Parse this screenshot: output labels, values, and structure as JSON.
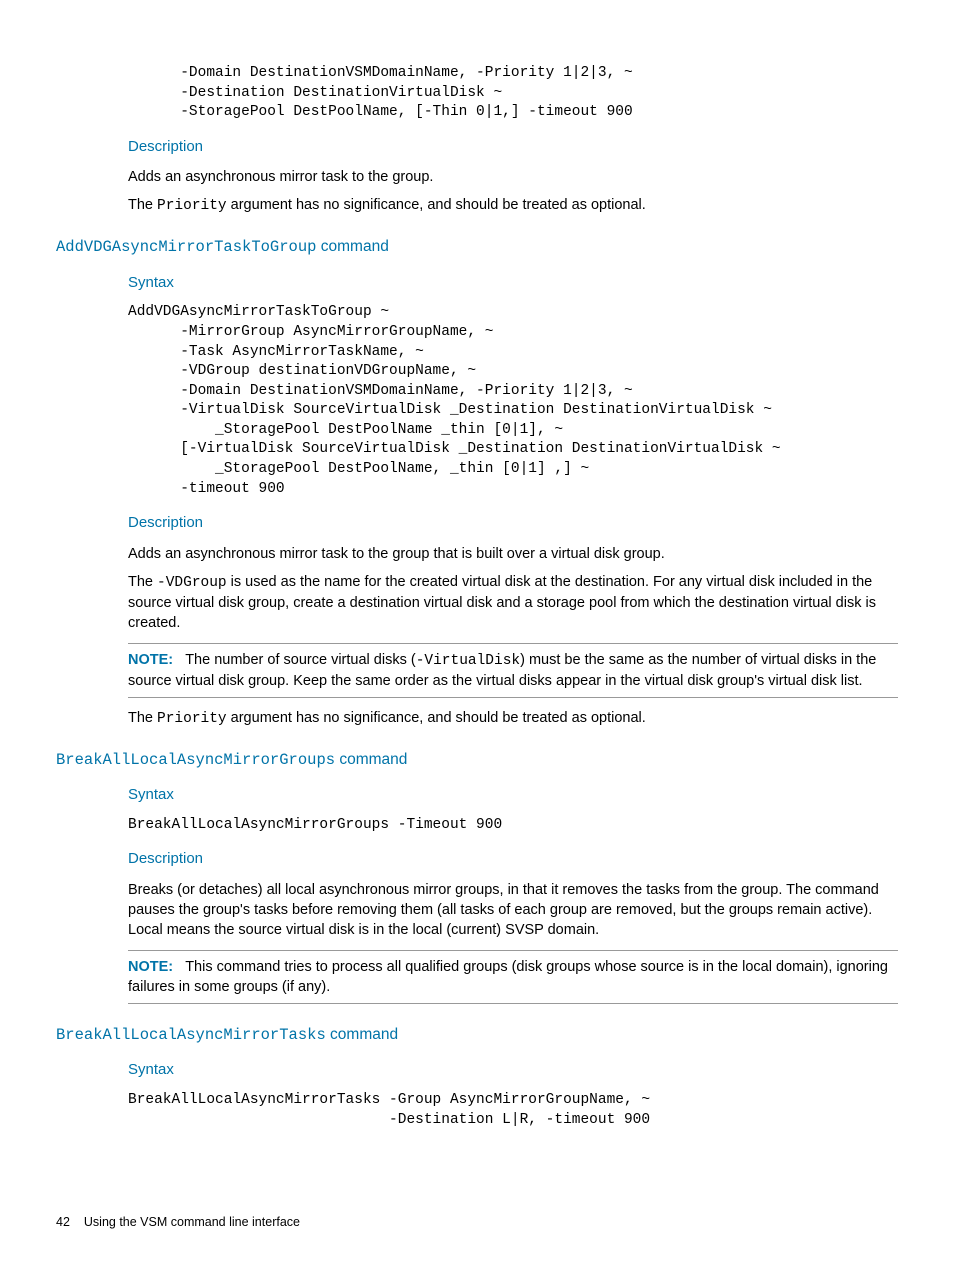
{
  "section1": {
    "code_frag": "      -Domain DestinationVSMDomainName, -Priority 1|2|3, ~\n      -Destination DestinationVirtualDisk ~\n      -StoragePool DestPoolName, [-Thin 0|1,] -timeout 900",
    "desc_h": "Description",
    "p1": "Adds an asynchronous mirror task to the group.",
    "p2a": "The ",
    "p2b": "Priority",
    "p2c": " argument has no significance, and should be treated as optional."
  },
  "section2": {
    "title_cmd": "AddVDGAsyncMirrorTaskToGroup",
    "title_suffix": " command",
    "syntax_h": "Syntax",
    "code": "AddVDGAsyncMirrorTaskToGroup ~\n      -MirrorGroup AsyncMirrorGroupName, ~\n      -Task AsyncMirrorTaskName, ~\n      -VDGroup destinationVDGroupName, ~\n      -Domain DestinationVSMDomainName, -Priority 1|2|3, ~\n      -VirtualDisk SourceVirtualDisk _Destination DestinationVirtualDisk ~\n          _StoragePool DestPoolName _thin [0|1], ~\n      [-VirtualDisk SourceVirtualDisk _Destination DestinationVirtualDisk ~\n          _StoragePool DestPoolName, _thin [0|1] ,] ~\n      -timeout 900",
    "desc_h": "Description",
    "p1": "Adds an asynchronous mirror task to the group that is built over a virtual disk group.",
    "p2a": "The ",
    "p2b": "-VDGroup",
    "p2c": " is used as the name for the created virtual disk at the destination. For any virtual disk included in the source virtual disk group, create a destination virtual disk and a storage pool from which the destination virtual disk is created.",
    "note_label": "NOTE:",
    "note_a": "The number of source virtual disks (",
    "note_b": "-VirtualDisk",
    "note_c": ") must be the same as the number of virtual disks in the source virtual disk group. Keep the same order as the virtual disks appear in the virtual disk group's virtual disk list.",
    "p3a": "The ",
    "p3b": "Priority",
    "p3c": " argument has no significance, and should be treated as optional."
  },
  "section3": {
    "title_cmd": "BreakAllLocalAsyncMirrorGroups",
    "title_suffix": " command",
    "syntax_h": "Syntax",
    "code": "BreakAllLocalAsyncMirrorGroups -Timeout 900",
    "desc_h": "Description",
    "p1": "Breaks (or detaches) all local asynchronous mirror groups, in that it removes the tasks from the group. The command pauses the group's tasks before removing them (all tasks of each group are removed, but the groups remain active). Local means the source virtual disk is in the local (current) SVSP domain.",
    "note_label": "NOTE:",
    "note_text": "This command tries to process all qualified groups (disk groups whose source is in the local domain), ignoring failures in some groups (if any)."
  },
  "section4": {
    "title_cmd": "BreakAllLocalAsyncMirrorTasks",
    "title_suffix": " command",
    "syntax_h": "Syntax",
    "code": "BreakAllLocalAsyncMirrorTasks -Group AsyncMirrorGroupName, ~\n                              -Destination L|R, -timeout 900"
  },
  "footer": {
    "page": "42",
    "chapter": "Using the VSM command line interface"
  }
}
